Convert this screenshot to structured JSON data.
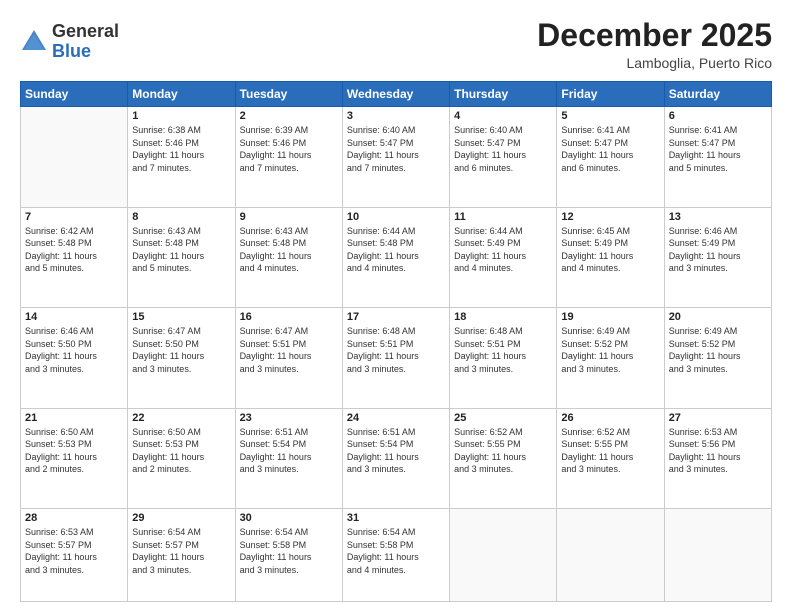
{
  "header": {
    "logo_general": "General",
    "logo_blue": "Blue",
    "month": "December 2025",
    "location": "Lamboglia, Puerto Rico"
  },
  "weekdays": [
    "Sunday",
    "Monday",
    "Tuesday",
    "Wednesday",
    "Thursday",
    "Friday",
    "Saturday"
  ],
  "weeks": [
    [
      {
        "day": "",
        "info": ""
      },
      {
        "day": "1",
        "info": "Sunrise: 6:38 AM\nSunset: 5:46 PM\nDaylight: 11 hours\nand 7 minutes."
      },
      {
        "day": "2",
        "info": "Sunrise: 6:39 AM\nSunset: 5:46 PM\nDaylight: 11 hours\nand 7 minutes."
      },
      {
        "day": "3",
        "info": "Sunrise: 6:40 AM\nSunset: 5:47 PM\nDaylight: 11 hours\nand 7 minutes."
      },
      {
        "day": "4",
        "info": "Sunrise: 6:40 AM\nSunset: 5:47 PM\nDaylight: 11 hours\nand 6 minutes."
      },
      {
        "day": "5",
        "info": "Sunrise: 6:41 AM\nSunset: 5:47 PM\nDaylight: 11 hours\nand 6 minutes."
      },
      {
        "day": "6",
        "info": "Sunrise: 6:41 AM\nSunset: 5:47 PM\nDaylight: 11 hours\nand 5 minutes."
      }
    ],
    [
      {
        "day": "7",
        "info": "Sunrise: 6:42 AM\nSunset: 5:48 PM\nDaylight: 11 hours\nand 5 minutes."
      },
      {
        "day": "8",
        "info": "Sunrise: 6:43 AM\nSunset: 5:48 PM\nDaylight: 11 hours\nand 5 minutes."
      },
      {
        "day": "9",
        "info": "Sunrise: 6:43 AM\nSunset: 5:48 PM\nDaylight: 11 hours\nand 4 minutes."
      },
      {
        "day": "10",
        "info": "Sunrise: 6:44 AM\nSunset: 5:48 PM\nDaylight: 11 hours\nand 4 minutes."
      },
      {
        "day": "11",
        "info": "Sunrise: 6:44 AM\nSunset: 5:49 PM\nDaylight: 11 hours\nand 4 minutes."
      },
      {
        "day": "12",
        "info": "Sunrise: 6:45 AM\nSunset: 5:49 PM\nDaylight: 11 hours\nand 4 minutes."
      },
      {
        "day": "13",
        "info": "Sunrise: 6:46 AM\nSunset: 5:49 PM\nDaylight: 11 hours\nand 3 minutes."
      }
    ],
    [
      {
        "day": "14",
        "info": "Sunrise: 6:46 AM\nSunset: 5:50 PM\nDaylight: 11 hours\nand 3 minutes."
      },
      {
        "day": "15",
        "info": "Sunrise: 6:47 AM\nSunset: 5:50 PM\nDaylight: 11 hours\nand 3 minutes."
      },
      {
        "day": "16",
        "info": "Sunrise: 6:47 AM\nSunset: 5:51 PM\nDaylight: 11 hours\nand 3 minutes."
      },
      {
        "day": "17",
        "info": "Sunrise: 6:48 AM\nSunset: 5:51 PM\nDaylight: 11 hours\nand 3 minutes."
      },
      {
        "day": "18",
        "info": "Sunrise: 6:48 AM\nSunset: 5:51 PM\nDaylight: 11 hours\nand 3 minutes."
      },
      {
        "day": "19",
        "info": "Sunrise: 6:49 AM\nSunset: 5:52 PM\nDaylight: 11 hours\nand 3 minutes."
      },
      {
        "day": "20",
        "info": "Sunrise: 6:49 AM\nSunset: 5:52 PM\nDaylight: 11 hours\nand 3 minutes."
      }
    ],
    [
      {
        "day": "21",
        "info": "Sunrise: 6:50 AM\nSunset: 5:53 PM\nDaylight: 11 hours\nand 2 minutes."
      },
      {
        "day": "22",
        "info": "Sunrise: 6:50 AM\nSunset: 5:53 PM\nDaylight: 11 hours\nand 2 minutes."
      },
      {
        "day": "23",
        "info": "Sunrise: 6:51 AM\nSunset: 5:54 PM\nDaylight: 11 hours\nand 3 minutes."
      },
      {
        "day": "24",
        "info": "Sunrise: 6:51 AM\nSunset: 5:54 PM\nDaylight: 11 hours\nand 3 minutes."
      },
      {
        "day": "25",
        "info": "Sunrise: 6:52 AM\nSunset: 5:55 PM\nDaylight: 11 hours\nand 3 minutes."
      },
      {
        "day": "26",
        "info": "Sunrise: 6:52 AM\nSunset: 5:55 PM\nDaylight: 11 hours\nand 3 minutes."
      },
      {
        "day": "27",
        "info": "Sunrise: 6:53 AM\nSunset: 5:56 PM\nDaylight: 11 hours\nand 3 minutes."
      }
    ],
    [
      {
        "day": "28",
        "info": "Sunrise: 6:53 AM\nSunset: 5:57 PM\nDaylight: 11 hours\nand 3 minutes."
      },
      {
        "day": "29",
        "info": "Sunrise: 6:54 AM\nSunset: 5:57 PM\nDaylight: 11 hours\nand 3 minutes."
      },
      {
        "day": "30",
        "info": "Sunrise: 6:54 AM\nSunset: 5:58 PM\nDaylight: 11 hours\nand 3 minutes."
      },
      {
        "day": "31",
        "info": "Sunrise: 6:54 AM\nSunset: 5:58 PM\nDaylight: 11 hours\nand 4 minutes."
      },
      {
        "day": "",
        "info": ""
      },
      {
        "day": "",
        "info": ""
      },
      {
        "day": "",
        "info": ""
      }
    ]
  ]
}
